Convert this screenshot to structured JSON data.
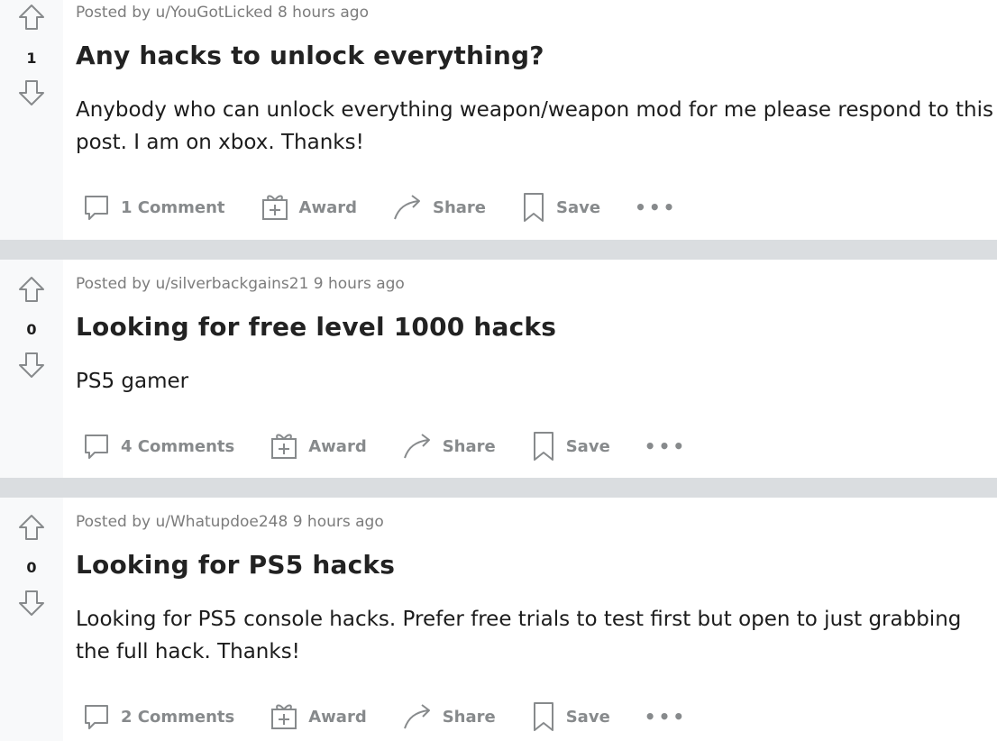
{
  "posts": [
    {
      "score": "1",
      "meta": "Posted by u/YouGotLicked 8 hours ago",
      "title": "Any hacks to unlock everything?",
      "body": "Anybody who can unlock everything weapon/weapon mod for me please respond to this post. I am on xbox. Thanks!",
      "comments_label": "1 Comment",
      "award_label": "Award",
      "share_label": "Share",
      "save_label": "Save",
      "more_label": "•••"
    },
    {
      "score": "0",
      "meta": "Posted by u/silverbackgains21 9 hours ago",
      "title": "Looking for free level 1000 hacks",
      "body": "PS5 gamer",
      "comments_label": "4 Comments",
      "award_label": "Award",
      "share_label": "Share",
      "save_label": "Save",
      "more_label": "•••"
    },
    {
      "score": "0",
      "meta": "Posted by u/Whatupdoe248 9 hours ago",
      "title": "Looking for PS5 hacks",
      "body": "Looking for PS5 console hacks. Prefer free trials to test first but open to just grabbing the full hack. Thanks!",
      "comments_label": "2 Comments",
      "award_label": "Award",
      "share_label": "Share",
      "save_label": "Save",
      "more_label": "•••"
    }
  ],
  "icons": {
    "upvote": "upvote-arrow-icon",
    "downvote": "downvote-arrow-icon",
    "comment": "comment-bubble-icon",
    "award": "gift-box-icon",
    "share": "share-arrow-icon",
    "save": "bookmark-icon"
  },
  "colors": {
    "icon_gray": "#878a8c",
    "separator": "#dadde0",
    "vote_column": "#f8f9fa"
  }
}
